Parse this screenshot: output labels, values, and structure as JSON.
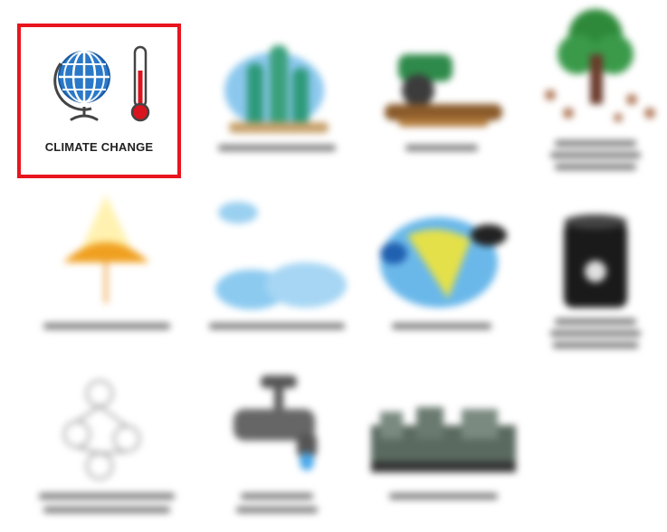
{
  "grid": {
    "highlighted_tile": {
      "label": "CLIMATE CHANGE",
      "icon": "globe-thermometer-icon",
      "highlight_color": "#e8141e"
    },
    "blurred_tiles": [
      {
        "icon": "cactus-desert-icon"
      },
      {
        "icon": "land-use-icon"
      },
      {
        "icon": "tree-icon"
      },
      {
        "icon": "lamp-ozone-icon"
      },
      {
        "icon": "clouds-icon"
      },
      {
        "icon": "globe-map-icon"
      },
      {
        "icon": "barrel-icon"
      },
      {
        "icon": "molecule-diagram-icon"
      },
      {
        "icon": "water-tap-icon"
      },
      {
        "icon": "city-skyline-icon"
      }
    ]
  }
}
